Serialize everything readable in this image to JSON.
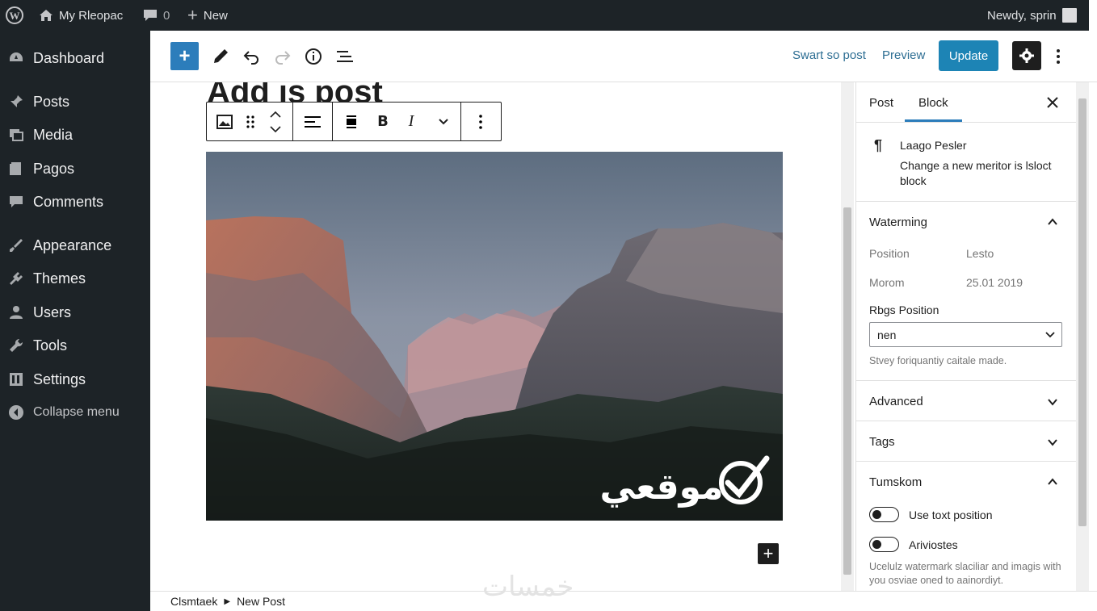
{
  "admin_bar": {
    "site_name": "My Rleopac",
    "comments_count": "0",
    "new_label": "New",
    "greeting": "Newdy, sprin"
  },
  "admin_menu": {
    "items": [
      {
        "label": "Dashboard",
        "icon": "dashboard-icon"
      },
      {
        "label": "Posts",
        "icon": "pin-icon"
      },
      {
        "label": "Media",
        "icon": "media-icon"
      },
      {
        "label": "Pagos",
        "icon": "page-icon"
      },
      {
        "label": "Comments",
        "icon": "comment-icon"
      },
      {
        "label": "Appearance",
        "icon": "brush-icon"
      },
      {
        "label": "Themes",
        "icon": "plugin-icon"
      },
      {
        "label": "Users",
        "icon": "user-icon"
      },
      {
        "label": "Tools",
        "icon": "wrench-icon"
      },
      {
        "label": "Settings",
        "icon": "settings-icon"
      }
    ],
    "collapse_label": "Collapse menu"
  },
  "editor_header": {
    "save_draft": "Swart so post",
    "preview": "Preview",
    "update": "Update"
  },
  "canvas": {
    "post_title": "Add is post",
    "image_watermark_text": "موقعي",
    "image_alt": "mountain valley landscape at dusk"
  },
  "footer": {
    "breadcrumb_root": "Clsmtaek",
    "breadcrumb_current": "New Post",
    "watermark": "خمسات"
  },
  "sidebar": {
    "tabs": [
      "Post",
      "Block"
    ],
    "active_tab": "Block",
    "block_card": {
      "title": "Laago Pesler",
      "description": "Change a new meritor is lsloct block"
    },
    "sections": {
      "watermarking": {
        "title": "Waterming",
        "rows": [
          {
            "label": "Position",
            "value": "Lesto"
          },
          {
            "label": "Morom",
            "value": "25.01 2019"
          }
        ],
        "select_label": "Rbgs Position",
        "select_value": "nen",
        "select_help": "Stvey foriquantiy caitale made."
      },
      "advanced": {
        "title": "Advanced"
      },
      "tags": {
        "title": "Tags"
      },
      "tumskom": {
        "title": "Tumskom",
        "toggles": [
          {
            "label": "Use toxt position",
            "checked": false
          },
          {
            "label": "Ariviostes",
            "checked": false
          }
        ],
        "help": "Ucelulz watermark slaciliar and imagis with you osviae oned to aainordiyt."
      }
    }
  },
  "colors": {
    "admin_dark": "#1d2327",
    "accent_blue": "#2c7dbb",
    "update_blue": "#1d84b5"
  }
}
